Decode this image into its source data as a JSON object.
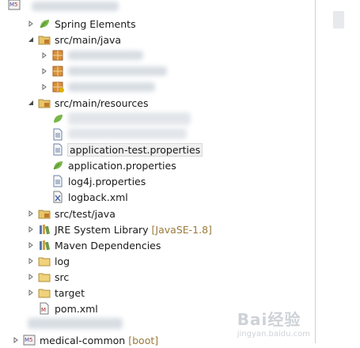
{
  "tree": {
    "rows": {
      "spring": "Spring Elements",
      "main_java": "src/main/java",
      "main_resources": "src/main/resources",
      "app_test": "application-test.properties",
      "app_props": "application.properties",
      "log4j": "log4j.properties",
      "logback": "logback.xml",
      "test_java": "src/test/java",
      "jre": "JRE System Library",
      "jre_decor": "[JavaSE-1.8]",
      "maven": "Maven Dependencies",
      "log": "log",
      "src": "src",
      "target": "target",
      "pom": "pom.xml",
      "medical": "medical-common",
      "medical_decor": "[boot]"
    }
  },
  "watermark": {
    "brand": "Bai经验",
    "url": "jingyan.baidu.com"
  },
  "colors": {
    "folder": "#e8c56a",
    "package": "#c07a2a",
    "leaf": "#7ab648",
    "decoration": "#9a7a3a",
    "selection": "#f0f0f0"
  }
}
